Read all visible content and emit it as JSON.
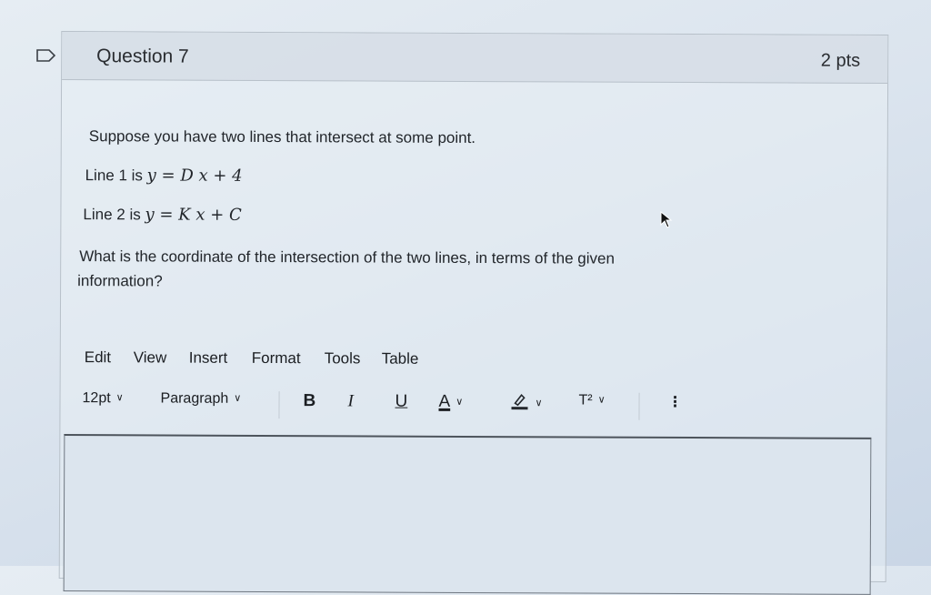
{
  "question": {
    "title": "Question 7",
    "points": "2 pts",
    "prompt": "Suppose you have two lines that intersect at some point.",
    "line1_label": "Line 1 is",
    "line1_eq": "y = D x + 4",
    "line2_label": "Line 2 is",
    "line2_eq": "y = K x + C",
    "ask_line1": "What is the coordinate of the intersection of the two lines, in terms of the given",
    "ask_line2": "information?"
  },
  "menubar": {
    "edit": "Edit",
    "view": "View",
    "insert": "Insert",
    "format": "Format",
    "tools": "Tools",
    "table": "Table"
  },
  "toolbar": {
    "font_size": "12pt",
    "block_format": "Paragraph",
    "bold": "B",
    "italic": "I",
    "underline": "U",
    "text_color": "A",
    "superscript": "T²",
    "more": "⋮"
  },
  "icons": {
    "flag": "flag-icon",
    "cursor": "mouse-pointer-icon",
    "highlight": "highlighter-icon"
  }
}
